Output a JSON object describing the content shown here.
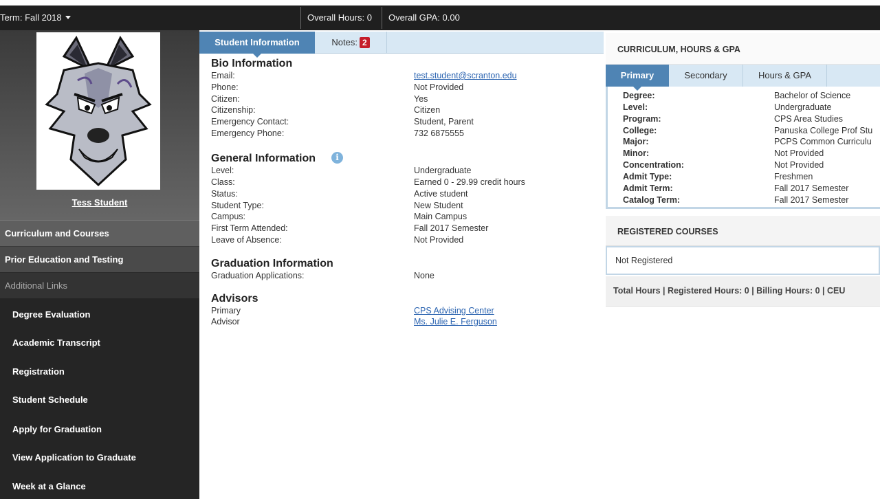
{
  "topbar": {
    "term_label": "Term: Fall 2018",
    "overall_hours": "Overall Hours: 0",
    "overall_gpa": "Overall GPA: 0.00"
  },
  "sidebar": {
    "student_name": "Tess Student",
    "sections": [
      "Curriculum and Courses",
      "Prior Education and Testing",
      "Additional Links"
    ],
    "links": [
      "Degree Evaluation",
      "Academic Transcript",
      "Registration",
      "Student Schedule",
      "Apply for Graduation",
      "View Application to Graduate",
      "Week at a Glance"
    ]
  },
  "tabs": {
    "student_information": "Student Information",
    "notes": "Notes:",
    "notes_count": "2"
  },
  "bio": {
    "heading": "Bio Information",
    "rows": [
      {
        "label": "Email:",
        "value": "test.student@scranton.edu"
      },
      {
        "label": "Phone:",
        "value": "Not Provided"
      },
      {
        "label": "Citizen:",
        "value": "Yes"
      },
      {
        "label": "Citizenship:",
        "value": "Citizen"
      },
      {
        "label": "Emergency Contact:",
        "value": "Student, Parent"
      },
      {
        "label": "Emergency Phone:",
        "value": "732 6875555"
      }
    ]
  },
  "general": {
    "heading": "General Information",
    "rows": [
      {
        "label": "Level:",
        "value": "Undergraduate"
      },
      {
        "label": "Class:",
        "value": "Earned 0 - 29.99 credit hours"
      },
      {
        "label": "Status:",
        "value": "Active student"
      },
      {
        "label": "Student Type:",
        "value": "New Student"
      },
      {
        "label": "Campus:",
        "value": "Main Campus"
      },
      {
        "label": "First Term Attended:",
        "value": "Fall 2017 Semester"
      },
      {
        "label": "Leave of Absence:",
        "value": "Not Provided"
      }
    ]
  },
  "graduation": {
    "heading": "Graduation Information",
    "rows": [
      {
        "label": "Graduation Applications:",
        "value": "None"
      }
    ]
  },
  "advisors": {
    "heading": "Advisors",
    "rows": [
      {
        "label": "Primary",
        "value": "CPS Advising Center"
      },
      {
        "label": "Advisor",
        "value": "Ms. Julie E. Ferguson"
      }
    ]
  },
  "curriculum": {
    "title": "CURRICULUM, HOURS & GPA",
    "tabs": [
      "Primary",
      "Secondary",
      "Hours & GPA"
    ],
    "rows": [
      {
        "label": "Degree:",
        "value": "Bachelor of Science"
      },
      {
        "label": "Level:",
        "value": "Undergraduate"
      },
      {
        "label": "Program:",
        "value": "CPS Area Studies"
      },
      {
        "label": "College:",
        "value": "Panuska College Prof Stu"
      },
      {
        "label": "Major:",
        "value": "PCPS Common Curriculu"
      },
      {
        "label": "Minor:",
        "value": "Not Provided"
      },
      {
        "label": "Concentration:",
        "value": "Not Provided"
      },
      {
        "label": "Admit Type:",
        "value": "Freshmen"
      },
      {
        "label": "Admit Term:",
        "value": "Fall 2017 Semester"
      },
      {
        "label": "Catalog Term:",
        "value": "Fall 2017 Semester"
      }
    ]
  },
  "registered": {
    "title": "REGISTERED COURSES",
    "status": "Not Registered",
    "footer": "Total Hours |  Registered Hours:  0  |  Billing Hours:  0  |  CEU"
  }
}
